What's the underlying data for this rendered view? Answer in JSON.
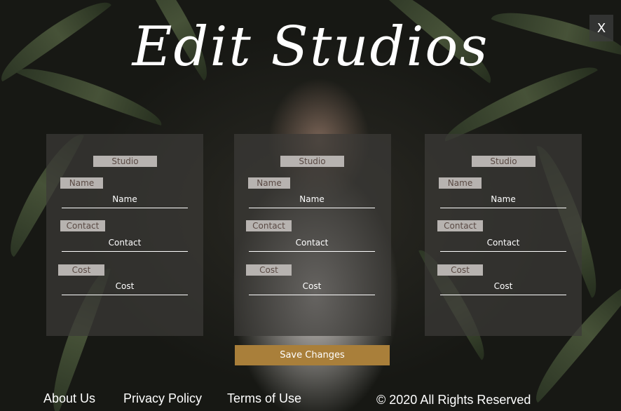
{
  "brand": {
    "logo_text": "Edit Studios"
  },
  "close_label": "X",
  "cards": [
    {
      "studio_label": "Studio",
      "name_label": "Name",
      "name_value": "Name",
      "contact_label": "Contact",
      "contact_value": "Contact",
      "cost_label": "Cost",
      "cost_value": "Cost"
    },
    {
      "studio_label": "Studio",
      "name_label": "Name",
      "name_value": "Name",
      "contact_label": "Contact",
      "contact_value": "Contact",
      "cost_label": "Cost",
      "cost_value": "Cost"
    },
    {
      "studio_label": "Studio",
      "name_label": "Name",
      "name_value": "Name",
      "contact_label": "Contact",
      "contact_value": "Contact",
      "cost_label": "Cost",
      "cost_value": "Cost"
    }
  ],
  "save_label": "Save Changes",
  "footer": {
    "about": "About Us",
    "privacy": "Privacy Policy",
    "terms": "Terms of Use",
    "copyright": "© 2020 All Rights Reserved"
  },
  "colors": {
    "accent": "#a97f3a",
    "card_bg": "#3c3a38",
    "pill_bg": "#b7b3b0"
  }
}
